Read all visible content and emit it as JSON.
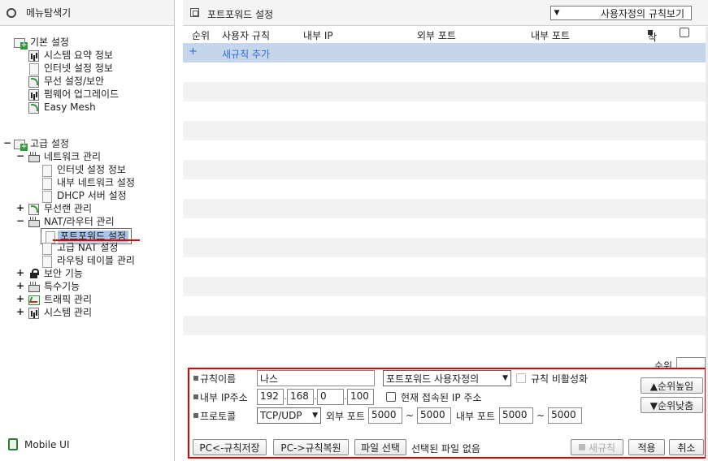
{
  "left": {
    "title": "메뉴탐색기",
    "basic": {
      "label": "기본 설정",
      "items": [
        "시스템 요약 정보",
        "인터넷 설정 정보",
        "무선 설정/보안",
        "펌웨어 업그레이드",
        "Easy Mesh"
      ]
    },
    "advanced": {
      "label": "고급 설정",
      "network": {
        "label": "네트워크 관리",
        "items": [
          "인터넷 설정 정보",
          "내부 네트워크 설정",
          "DHCP 서버 설정"
        ]
      },
      "wireless": "무선랜 관리",
      "nat": {
        "label": "NAT/라우터 관리",
        "items": [
          "포트포워드 설정",
          "고급 NAT 설정",
          "라우팅 테이블 관리"
        ]
      },
      "security": "보안 기능",
      "special": "특수기능",
      "traffic": "트래픽 관리",
      "system": "시스템 관리"
    },
    "expanders": {
      "minus": "−",
      "plus": "+"
    },
    "mobile": "Mobile UI"
  },
  "main": {
    "title": "포트포워드 설정",
    "view_select": "사용자정의 규칙보기",
    "columns": {
      "rank": "순위",
      "user_rule": "사용자 규칙",
      "internal_ip": "내부 IP",
      "external_port": "외부 포트",
      "internal_port": "내부 포트",
      "delete": "삭제"
    },
    "add_rule": {
      "icon": "+",
      "label": "새규칙 추가"
    },
    "rank_label": "순위"
  },
  "form": {
    "rule_name_label": "규칙이름",
    "rule_name_value": "나스",
    "rule_type": "포트포워드 사용자정의",
    "disable_rule": "규칙 비활성화",
    "ip_label": "내부 IP주소",
    "ip": [
      "192",
      "168",
      "0",
      "100"
    ],
    "current_ip": "현재 접속된 IP 주소",
    "protocol_label": "프로토콜",
    "protocol": "TCP/UDP",
    "ext_port_label": "외부 포트",
    "ext_port_from": "5000",
    "ext_port_to": "5000",
    "int_port_label": "내부 포트",
    "int_port_from": "5000",
    "int_port_to": "5000",
    "tilde": "~",
    "rank_up": "▲순위높임",
    "rank_down": "▼순위낮춤",
    "save_to_pc": "PC<-규칙저장",
    "restore_from_pc": "PC->규칙복원",
    "file_select": "파일 선택",
    "no_file": "선택된 파일 없음",
    "new_rule": "새규칙",
    "apply": "적용",
    "cancel": "취소"
  }
}
